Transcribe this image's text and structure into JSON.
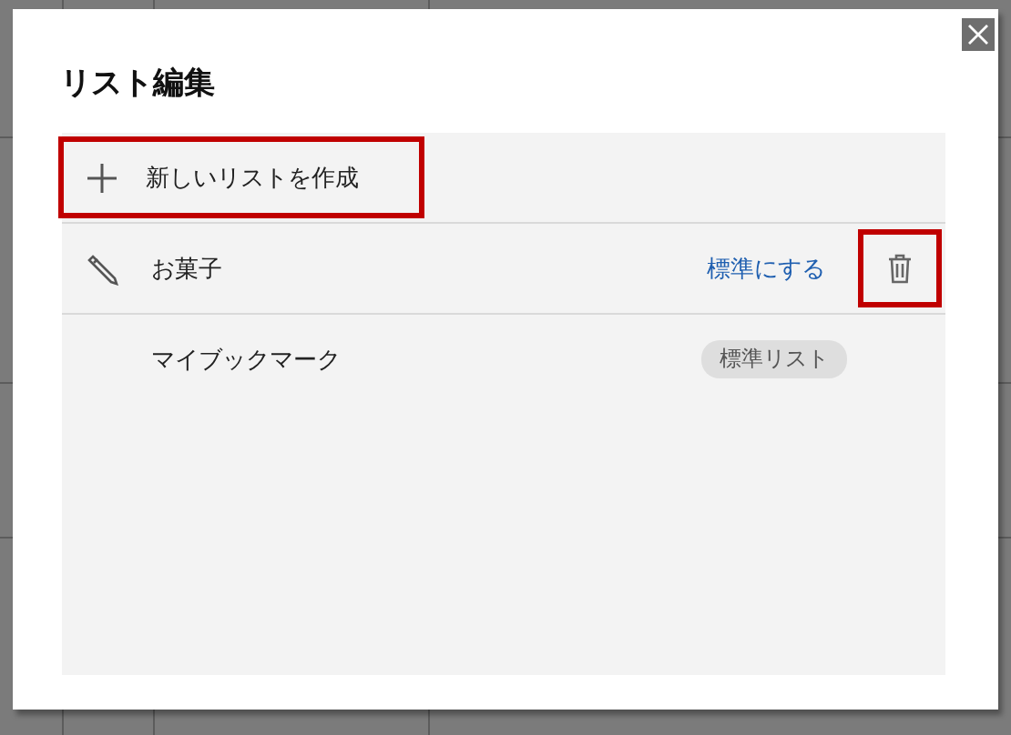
{
  "dialog": {
    "title": "リスト編集",
    "create_button": {
      "label": "新しいリストを作成",
      "highlighted": true
    },
    "lists": [
      {
        "kind": "custom",
        "name": "お菓子",
        "action": "標準にする",
        "delete_highlighted": true
      },
      {
        "kind": "default",
        "name": "マイブックマーク",
        "badge": "標準リスト"
      }
    ]
  }
}
